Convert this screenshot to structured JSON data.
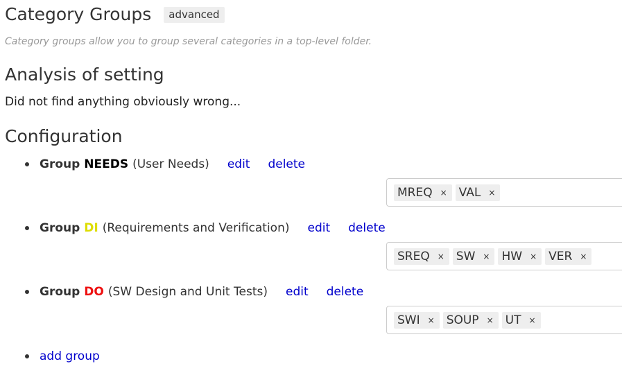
{
  "header": {
    "title": "Category Groups",
    "badge": "advanced",
    "subtitle": "Category groups allow you to group several categories in a top-level folder."
  },
  "analysis": {
    "heading": "Analysis of setting",
    "text": "Did not find anything obviously wrong..."
  },
  "configuration": {
    "heading": "Configuration",
    "group_word": "Group",
    "edit_label": "edit",
    "delete_label": "delete",
    "groups": [
      {
        "name": "NEEDS",
        "name_color": "#000000",
        "description": "(User Needs)",
        "tags": [
          "MREQ",
          "VAL"
        ]
      },
      {
        "name": "DI",
        "name_color": "#dddd00",
        "description": "(Requirements and Verification)",
        "tags": [
          "SREQ",
          "SW",
          "HW",
          "VER"
        ]
      },
      {
        "name": "DO",
        "name_color": "#ee1111",
        "description": "(SW Design and Unit Tests)",
        "tags": [
          "SWI",
          "SOUP",
          "UT"
        ]
      }
    ],
    "tag_remove_glyph": "×",
    "add_group_label": "add group"
  }
}
